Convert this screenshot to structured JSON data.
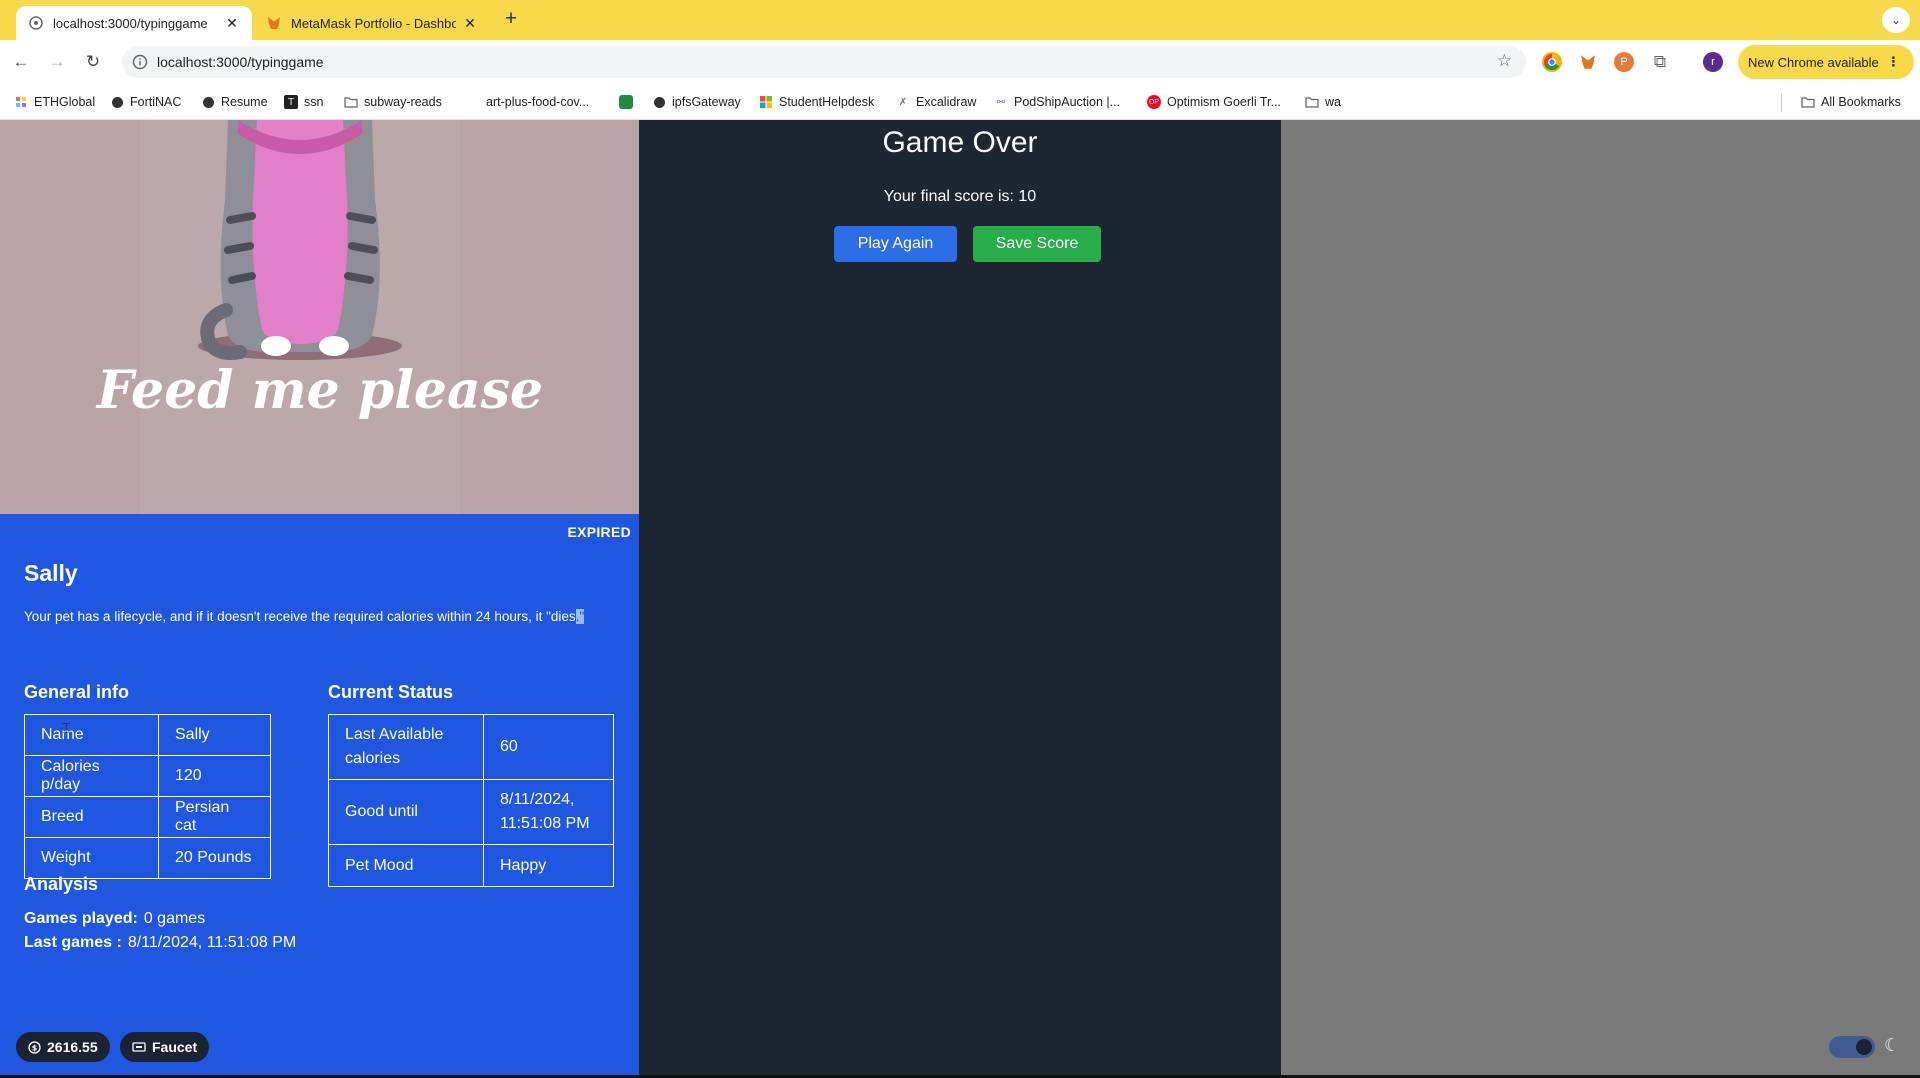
{
  "browser": {
    "tabs": [
      {
        "title": "localhost:3000/typinggame",
        "active": true
      },
      {
        "title": "MetaMask Portfolio - Dashbo",
        "active": false
      }
    ],
    "address": "localhost:3000/typinggame",
    "new_chrome_label": "New Chrome available",
    "profile_initial": "r",
    "ext_letter": "P",
    "bookmarks": [
      "ETHGlobal",
      "FortiNAC",
      "Resume",
      "ssn",
      "subway-reads",
      "art-plus-food-cov...",
      "ipfsGateway",
      "StudentHelpdesk",
      "Excalidraw",
      "PodShipAuction |...",
      "Optimism Goerli Tr...",
      "wa"
    ],
    "ssn_icon_letter": "T",
    "op_icon_letter": "OP",
    "all_bookmarks_label": "All Bookmarks"
  },
  "pet": {
    "image_caption": "Feed me please",
    "status_badge": "EXPIRED",
    "name": "Sally",
    "description_main": "Your pet has a lifecycle, and if it doesn't receive the required calories within 24 hours, it \"dies",
    "description_highlight": ".\"",
    "general_info_title": "General info",
    "general_info": [
      {
        "label": "Name",
        "value": "Sally"
      },
      {
        "label": "Calories p/day",
        "value": "120"
      },
      {
        "label": "Breed",
        "value": "Persian cat"
      },
      {
        "label": "Weight",
        "value": "20 Pounds"
      }
    ],
    "status_title": "Current Status",
    "status": [
      {
        "label": "Last Available calories",
        "value": "60"
      },
      {
        "label": "Good until",
        "value": "8/11/2024, 11:51:08 PM"
      },
      {
        "label": "Pet Mood",
        "value": "Happy"
      }
    ],
    "analysis_title": "Analysis",
    "games_played_label": "Games played:",
    "games_played_value": "0 games",
    "last_games_label": "Last games :",
    "last_games_value": "8/11/2024, 11:51:08 PM"
  },
  "wallet": {
    "balance": "2616.55",
    "faucet_label": "Faucet"
  },
  "game": {
    "title": "Game Over",
    "final_score_text": "Your final score is: 10",
    "play_again_label": "Play Again",
    "save_score_label": "Save Score"
  },
  "colors": {
    "tab_strip": "#f8d94a",
    "pet_card": "#2057e0",
    "game_panel": "#1e2533",
    "play_button": "#2b6ee8",
    "save_button": "#27ad4a"
  }
}
